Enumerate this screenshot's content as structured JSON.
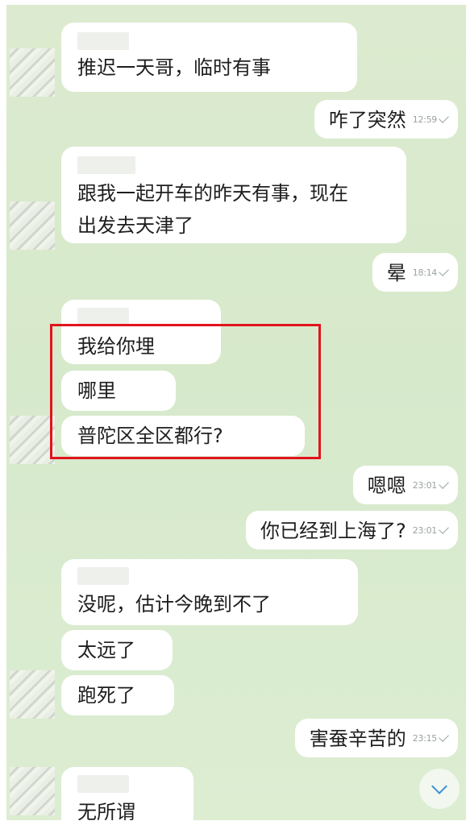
{
  "messages": [
    {
      "dir": "in",
      "text": "推迟一天哥，临时有事"
    },
    {
      "dir": "out",
      "text": "咋了突然",
      "time": "12:59"
    },
    {
      "dir": "in",
      "line1": "跟我一起开车的昨天有事，现在",
      "line2": "出发去天津了"
    },
    {
      "dir": "out",
      "text": "晕",
      "time": "18:14"
    },
    {
      "dir": "in",
      "text": "我给你埋"
    },
    {
      "dir": "in",
      "text": "哪里"
    },
    {
      "dir": "in",
      "text": "普陀区全区都行?"
    },
    {
      "dir": "out",
      "text": "嗯嗯",
      "time": "23:01"
    },
    {
      "dir": "out",
      "text": "你已经到上海了?",
      "time": "23:01"
    },
    {
      "dir": "in",
      "text": "没呢，估计今晚到不了"
    },
    {
      "dir": "in",
      "text": "太远了"
    },
    {
      "dir": "in",
      "text": "跑死了"
    },
    {
      "dir": "out",
      "text": "害蚕辛苦的",
      "time": "23:15"
    },
    {
      "dir": "in",
      "text": "无所谓"
    }
  ],
  "colors": {
    "background": "#d9eacd",
    "bubble": "#ffffff",
    "highlight": "#e2141c",
    "accent": "#3a8fd6"
  },
  "icons": {
    "read_receipt": "check-icon",
    "scroll": "chevron-down-icon"
  }
}
